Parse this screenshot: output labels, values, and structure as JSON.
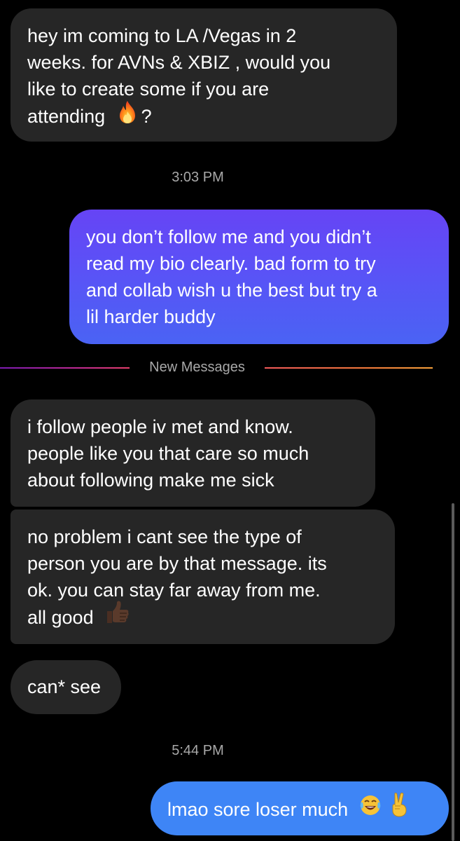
{
  "thread": {
    "messages": [
      {
        "sender": "other",
        "lines": [
          "hey im coming to LA /Vegas in 2",
          "weeks. for AVNs & XBIZ , would you",
          "like to create some  if you are",
          "attending"
        ],
        "tail_text": "?",
        "emoji": "fire-emoji"
      },
      {
        "sender": "me",
        "lines": [
          "you don’t follow me and you didn’t",
          "read my bio clearly. bad form to try",
          "and collab wish u the best but try a",
          "lil harder buddy"
        ]
      },
      {
        "sender": "other",
        "lines": [
          "i follow people iv met and know.",
          "people like you that care so much",
          "about following make me sick"
        ]
      },
      {
        "sender": "other",
        "lines": [
          "no problem i cant see the type of",
          "person you are by that message. its",
          "ok. you can stay far away from me.",
          "all good"
        ],
        "emoji": "thumbs-up-emoji"
      },
      {
        "sender": "other",
        "lines": [
          "can* see"
        ]
      },
      {
        "sender": "me",
        "lines": [
          "lmao sore loser much"
        ],
        "emoji": [
          "laughing-tears-emoji",
          "victory-hand-emoji"
        ]
      }
    ],
    "timestamps": [
      "3:03 PM",
      "5:44 PM"
    ],
    "new_messages_label": "New Messages"
  },
  "colors": {
    "background": "#000000",
    "incoming_bubble": "#262626",
    "outgoing_bubble_purple": "#5a52f6",
    "outgoing_bubble_blue": "#3e85f6",
    "meta_text": "#a8a8a8"
  }
}
